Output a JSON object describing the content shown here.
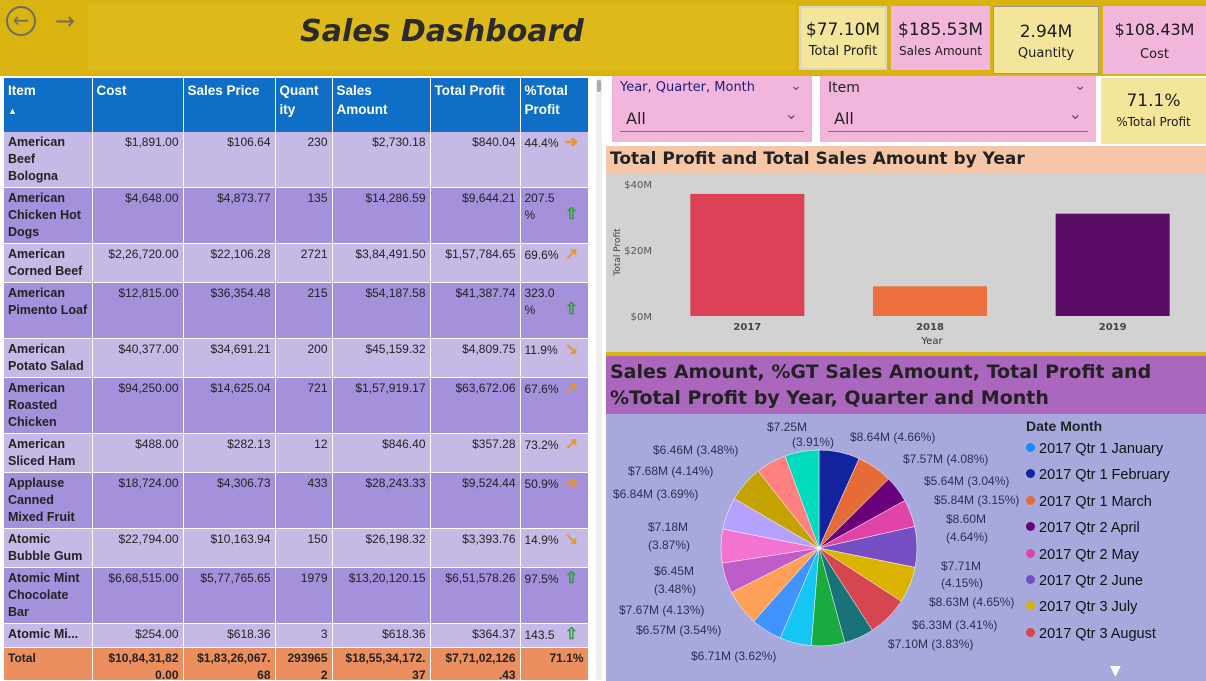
{
  "header": {
    "title": "Sales Dashboard",
    "back_icon": "back-arrow-icon",
    "forward_icon": "forward-arrow-icon"
  },
  "kpis": [
    {
      "value": "$77.10M",
      "label": "Total Profit"
    },
    {
      "value": "$185.53M",
      "label": "Sales Amount"
    },
    {
      "value": "2.94M",
      "label": "Quantity"
    },
    {
      "value": "$108.43M",
      "label": "Cost"
    },
    {
      "value": "71.1%",
      "label": "%Total Profit"
    }
  ],
  "slicers": {
    "date": {
      "title": "Year, Quarter, Month",
      "value": "All"
    },
    "item": {
      "title": "Item",
      "value": "All"
    }
  },
  "table": {
    "columns": [
      "Item",
      "Cost",
      "Sales Price",
      "Quant ity",
      "Sales Amount",
      "Total Profit",
      "%Total Profit"
    ],
    "sort_indicator": "▲",
    "rows": [
      {
        "item": "American Beef Bologna",
        "cost": "$1,891.00",
        "price": "$106.64",
        "qty": "230",
        "sales": "$2,730.18",
        "profit": "$840.04",
        "pct": "44.4%",
        "arrow": "right"
      },
      {
        "item": "American Chicken Hot Dogs",
        "cost": "$4,648.00",
        "price": "$4,873.77",
        "qty": "135",
        "sales": "$14,286.59",
        "profit": "$9,644.21",
        "pct": "207.5 %",
        "arrow": "up"
      },
      {
        "item": "American Corned Beef",
        "cost": "$2,26,720.00",
        "price": "$22,106.28",
        "qty": "2721",
        "sales": "$3,84,491.50",
        "profit": "$1,57,784.65",
        "pct": "69.6%",
        "arrow": "upright"
      },
      {
        "item": "American Pimento Loaf",
        "cost": "$12,815.00",
        "price": "$36,354.48",
        "qty": "215",
        "sales": "$54,187.58",
        "profit": "$41,387.74",
        "pct": "323.0 %",
        "arrow": "up"
      },
      {
        "item": "American Potato Salad",
        "cost": "$40,377.00",
        "price": "$34,691.21",
        "qty": "200",
        "sales": "$45,159.32",
        "profit": "$4,809.75",
        "pct": "11.9%",
        "arrow": "downright"
      },
      {
        "item": "American Roasted Chicken",
        "cost": "$94,250.00",
        "price": "$14,625.04",
        "qty": "721",
        "sales": "$1,57,919.17",
        "profit": "$63,672.06",
        "pct": "67.6%",
        "arrow": "upright"
      },
      {
        "item": "American Sliced Ham",
        "cost": "$488.00",
        "price": "$282.13",
        "qty": "12",
        "sales": "$846.40",
        "profit": "$357.28",
        "pct": "73.2%",
        "arrow": "upright"
      },
      {
        "item": "Applause Canned Mixed Fruit",
        "cost": "$18,724.00",
        "price": "$4,306.73",
        "qty": "433",
        "sales": "$28,243.33",
        "profit": "$9,524.44",
        "pct": "50.9%",
        "arrow": "right"
      },
      {
        "item": "Atomic Bubble Gum",
        "cost": "$22,794.00",
        "price": "$10,163.94",
        "qty": "150",
        "sales": "$26,198.32",
        "profit": "$3,393.76",
        "pct": "14.9%",
        "arrow": "downright"
      },
      {
        "item": "Atomic Mint Chocolate Bar",
        "cost": "$6,68,515.00",
        "price": "$5,77,765.65",
        "qty": "1979",
        "sales": "$13,20,120.15",
        "profit": "$6,51,578.26",
        "pct": "97.5%",
        "arrow": "up"
      },
      {
        "item": "Atomic Mi...",
        "cost": "$254.00",
        "price": "$618.36",
        "qty": "3",
        "sales": "$618.36",
        "profit": "$364.37",
        "pct": "143.5",
        "arrow": "up"
      }
    ],
    "total": {
      "label": "Total",
      "cost": "$10,84,31,82 0.00",
      "price": "$1,83,26,067. 68",
      "qty": "293965 2",
      "sales": "$18,55,34,172. 37",
      "profit": "$7,71,02,126 .43",
      "pct": "71.1%"
    }
  },
  "bar_chart": {
    "title": "Total Profit and Total Sales Amount by Year",
    "colors": [
      "#dd4158",
      "#ec6f3d",
      "#5a0c67"
    ]
  },
  "pie_chart": {
    "title": "Sales Amount, %GT Sales Amount, Total Profit and %Total Profit by Year, Quarter and Month",
    "legend_title": "Date Month",
    "labels": [
      "$7.25M",
      "(3.91%)",
      "$8.64M (4.66%)",
      "$6.46M (3.48%)",
      "$7.57M (4.08%)",
      "$7.68M (4.14%)",
      "$5.64M (3.04%)",
      "$6.84M (3.69%)",
      "$5.84M (3.15%)",
      "$8.60M",
      "(4.64%)",
      "$7.18M",
      "(3.87%)",
      "$6.45M",
      "(3.48%)",
      "$7.71M",
      "(4.15%)",
      "$8.63M (4.65%)",
      "$7.67M (4.13%)",
      "$6.33M (3.41%)",
      "$6.57M (3.54%)",
      "$7.10M (3.83%)",
      "$6.71M (3.62%)"
    ],
    "legend": [
      {
        "label": "2017 Qtr 1 January",
        "color": "#118dff"
      },
      {
        "label": "2017 Qtr 1 February",
        "color": "#12239e"
      },
      {
        "label": "2017 Qtr 1 March",
        "color": "#e66c37"
      },
      {
        "label": "2017 Qtr 2 April",
        "color": "#6b007b"
      },
      {
        "label": "2017 Qtr 2 May",
        "color": "#e044a7"
      },
      {
        "label": "2017 Qtr 2 June",
        "color": "#744ec2"
      },
      {
        "label": "2017 Qtr 3 July",
        "color": "#d9b300"
      },
      {
        "label": "2017 Qtr 3 August",
        "color": "#d64550"
      }
    ]
  },
  "chart_data": [
    {
      "type": "bar",
      "title": "Total Profit and Total Sales Amount by Year",
      "categories": [
        "2017",
        "2018",
        "2019"
      ],
      "values": [
        37,
        9,
        31
      ],
      "xlabel": "Year",
      "ylabel": "Total Profit",
      "yticks": [
        "$0M",
        "$20M",
        "$40M"
      ],
      "ylim": [
        0,
        40
      ]
    },
    {
      "type": "pie",
      "title": "Sales Amount, %GT Sales Amount, Total Profit and %Total Profit by Year, Quarter and Month",
      "values": [
        8.64,
        7.57,
        5.64,
        5.84,
        8.6,
        7.71,
        8.63,
        6.33,
        7.1,
        6.71,
        6.57,
        7.67,
        6.45,
        7.18,
        6.84,
        7.68,
        6.46,
        7.25
      ],
      "colors": [
        "#12239e",
        "#e66c37",
        "#6b007b",
        "#e044a7",
        "#744ec2",
        "#d9b300",
        "#d64550",
        "#197278",
        "#1aab40",
        "#15c6f4",
        "#4092ff",
        "#ffa058",
        "#be5dc9",
        "#f472d0",
        "#b5a1ff",
        "#c4a200",
        "#ff8080",
        "#00dbbc"
      ]
    }
  ]
}
